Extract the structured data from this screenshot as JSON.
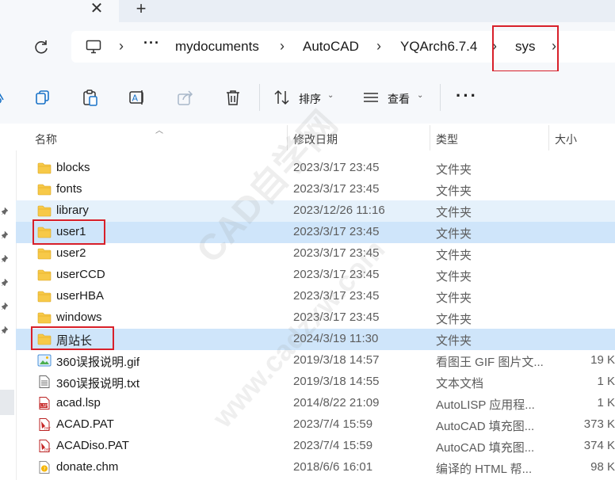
{
  "tabs": {
    "close_glyph": "✕",
    "new_glyph": "+"
  },
  "address": {
    "breadcrumbs": [
      {
        "label": "mydocuments"
      },
      {
        "label": "AutoCAD"
      },
      {
        "label": "YQArch6.7.4"
      },
      {
        "label": "sys"
      }
    ],
    "ellipsis": "···",
    "separator": "›"
  },
  "toolbar": {
    "sort_label": "排序",
    "view_label": "查看",
    "more_label": "···",
    "caret": "⌄"
  },
  "columns": {
    "name": "名称",
    "date": "修改日期",
    "type": "类型",
    "size": "大小"
  },
  "files": [
    {
      "name": "blocks",
      "date": "2023/3/17 23:45",
      "type": "文件夹",
      "size": "",
      "icon": "folder-icon",
      "state": ""
    },
    {
      "name": "fonts",
      "date": "2023/3/17 23:45",
      "type": "文件夹",
      "size": "",
      "icon": "folder-icon",
      "state": ""
    },
    {
      "name": "library",
      "date": "2023/12/26 11:16",
      "type": "文件夹",
      "size": "",
      "icon": "folder-icon",
      "state": "hover"
    },
    {
      "name": "user1",
      "date": "2023/3/17 23:45",
      "type": "文件夹",
      "size": "",
      "icon": "folder-icon",
      "state": "selected"
    },
    {
      "name": "user2",
      "date": "2023/3/17 23:45",
      "type": "文件夹",
      "size": "",
      "icon": "folder-icon",
      "state": ""
    },
    {
      "name": "userCCD",
      "date": "2023/3/17 23:45",
      "type": "文件夹",
      "size": "",
      "icon": "folder-icon",
      "state": ""
    },
    {
      "name": "userHBA",
      "date": "2023/3/17 23:45",
      "type": "文件夹",
      "size": "",
      "icon": "folder-icon",
      "state": ""
    },
    {
      "name": "windows",
      "date": "2023/3/17 23:45",
      "type": "文件夹",
      "size": "",
      "icon": "folder-icon",
      "state": ""
    },
    {
      "name": "周站长",
      "date": "2024/3/19 11:30",
      "type": "文件夹",
      "size": "",
      "icon": "folder-icon",
      "state": "selected"
    },
    {
      "name": "360误报说明.gif",
      "date": "2019/3/18 14:57",
      "type": "看图王 GIF 图片文...",
      "size": "19 K",
      "icon": "gif-icon",
      "state": ""
    },
    {
      "name": "360误报说明.txt",
      "date": "2019/3/18 14:55",
      "type": "文本文档",
      "size": "1 K",
      "icon": "text-file-icon",
      "state": ""
    },
    {
      "name": "acad.lsp",
      "date": "2014/8/22 21:09",
      "type": "AutoLISP 应用程...",
      "size": "1 K",
      "icon": "lisp-file-icon",
      "state": ""
    },
    {
      "name": "ACAD.PAT",
      "date": "2023/7/4 15:59",
      "type": "AutoCAD 填充图...",
      "size": "373 K",
      "icon": "pat-file-icon",
      "state": ""
    },
    {
      "name": "ACADiso.PAT",
      "date": "2023/7/4 15:59",
      "type": "AutoCAD 填充图...",
      "size": "374 K",
      "icon": "pat-file-icon",
      "state": ""
    },
    {
      "name": "donate.chm",
      "date": "2018/6/6 16:01",
      "type": "编译的 HTML 帮...",
      "size": "98 K",
      "icon": "help-file-icon",
      "state": ""
    }
  ],
  "watermark": {
    "main": "CAD自学网",
    "url": "www.cadzxw.com"
  },
  "colors": {
    "folder": "#f7c948",
    "selected_row": "#cfe5fa",
    "hover_row": "#e5f1fb",
    "highlight_box": "#d8202a"
  }
}
